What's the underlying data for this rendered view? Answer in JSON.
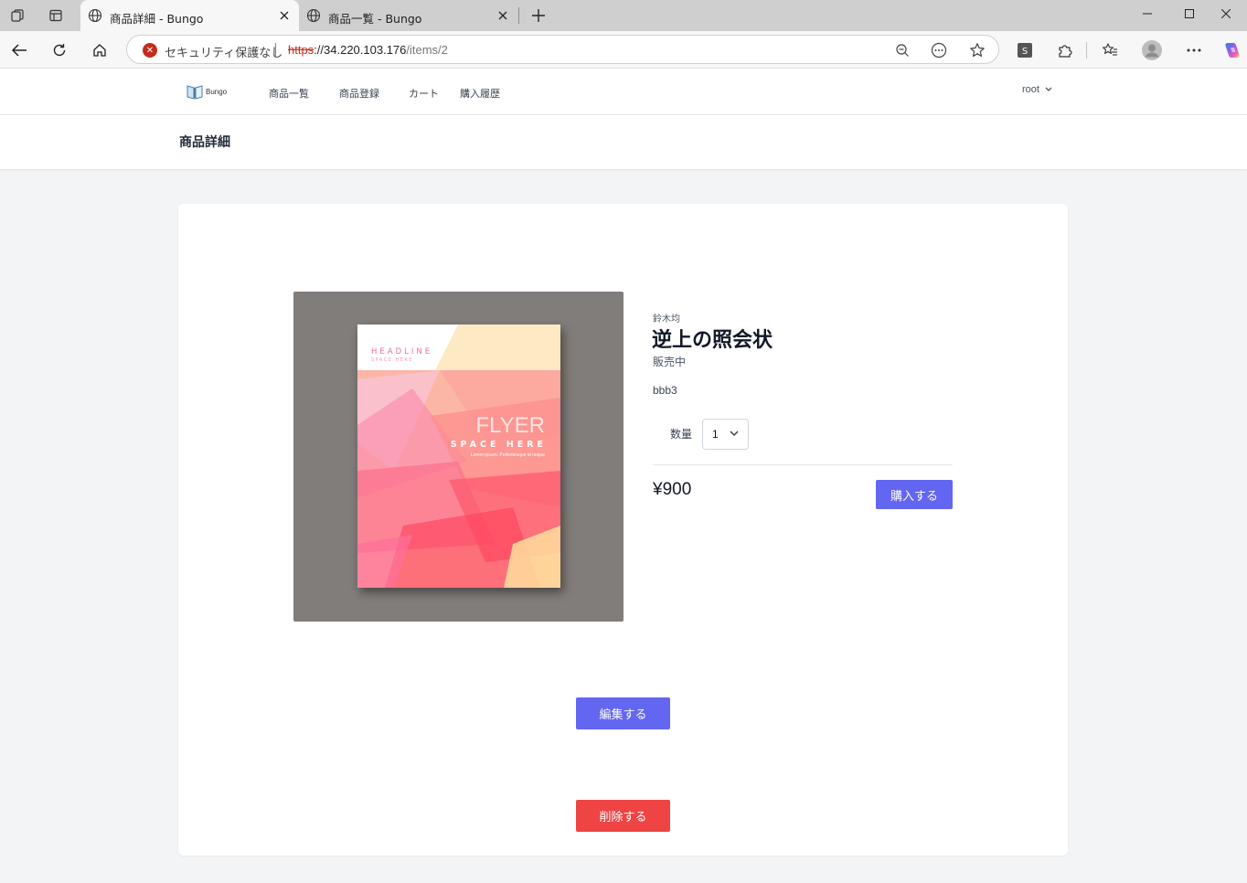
{
  "browser": {
    "tabs": [
      {
        "title": "商品詳細 - Bungo",
        "active": true
      },
      {
        "title": "商品一覧 - Bungo",
        "active": false
      }
    ],
    "security_label": "セキュリティ保護なし",
    "url": {
      "scheme": "https",
      "rest": "://34.220.103.176",
      "path": "/items/2"
    }
  },
  "site": {
    "logo_text": "Bungo",
    "nav": [
      "商品一覧",
      "商品登録",
      "カート",
      "購入履歴"
    ],
    "user": "root"
  },
  "page": {
    "title": "商品詳細"
  },
  "product": {
    "author": "鈴木均",
    "title": "逆上の照会状",
    "status": "販売中",
    "description": "bbb3",
    "quantity_label": "数量",
    "quantity_value": "1",
    "price": "¥900",
    "buy_label": "購入する",
    "edit_label": "編集する",
    "delete_label": "削除する",
    "image_text": {
      "headline": "HEADLINE",
      "subhead": "SPACE HERE",
      "flyer": "FLYER",
      "space": "SPACE HERE",
      "lorem": "Lorem ipsum. Pellentesque id neque"
    }
  },
  "colors": {
    "accent": "#6366f1",
    "danger": "#ef4444",
    "page_bg": "#f3f4f6",
    "image_bg": "#817d7a"
  }
}
